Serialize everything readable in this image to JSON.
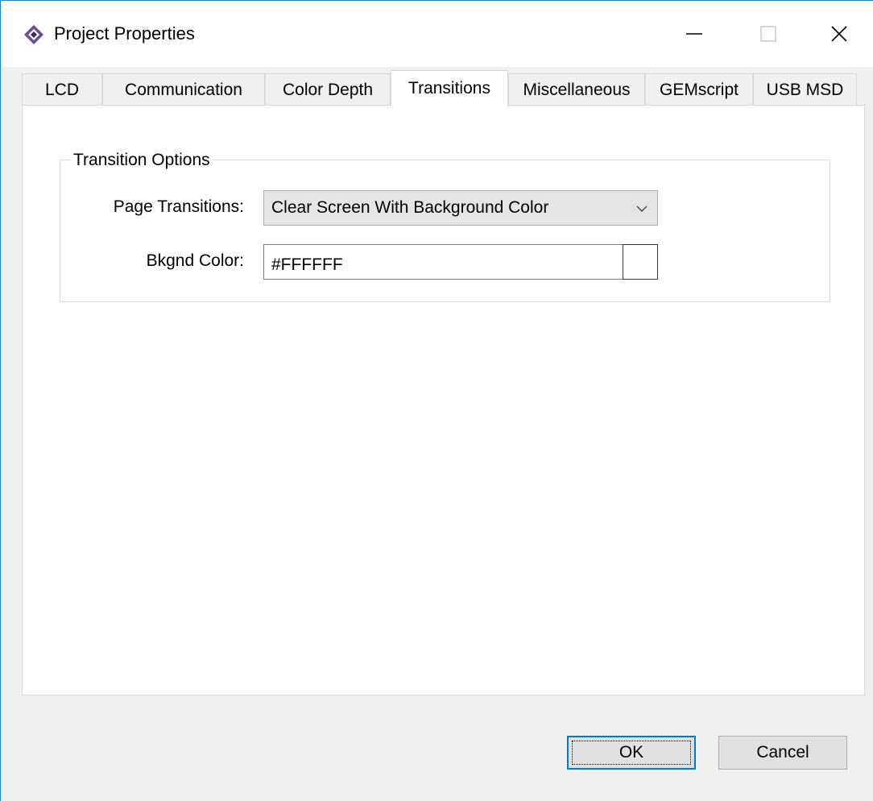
{
  "window": {
    "title": "Project Properties",
    "icon": "diamond-app-icon",
    "controls": {
      "minimize_icon": "minimize-icon",
      "maximize_icon": "maximize-icon",
      "close_icon": "close-icon"
    }
  },
  "tabs": [
    {
      "label": "LCD",
      "active": false
    },
    {
      "label": "Communication",
      "active": false
    },
    {
      "label": "Color Depth",
      "active": false
    },
    {
      "label": "Transitions",
      "active": true
    },
    {
      "label": "Miscellaneous",
      "active": false
    },
    {
      "label": "GEMscript",
      "active": false
    },
    {
      "label": "USB MSD",
      "active": false
    }
  ],
  "transition_options": {
    "group_title": "Transition Options",
    "page_transitions_label": "Page Transitions:",
    "page_transitions_value": "Clear Screen With Background Color",
    "bkgnd_color_label": "Bkgnd Color:",
    "bkgnd_color_value": "#FFFFFF",
    "swatch_color": "#FFFFFF"
  },
  "buttons": {
    "ok_label": "OK",
    "cancel_label": "Cancel"
  },
  "colors": {
    "accent": "#0078d7",
    "window_border": "#1883d7",
    "dialog_bg": "#f0f0f0"
  }
}
